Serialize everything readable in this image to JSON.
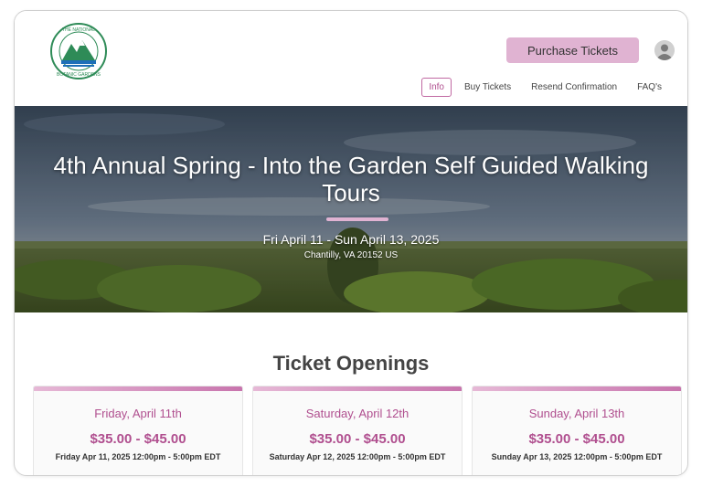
{
  "header": {
    "logo_text": "THE NATIONAL BOTANIC GARDENS",
    "purchase_button": "Purchase Tickets",
    "nav": [
      {
        "label": "Info",
        "active": true
      },
      {
        "label": "Buy Tickets",
        "active": false
      },
      {
        "label": "Resend Confirmation",
        "active": false
      },
      {
        "label": "FAQ's",
        "active": false
      }
    ]
  },
  "hero": {
    "title": "4th Annual Spring - Into the Garden Self Guided Walking Tours",
    "dates": "Fri April 11 - Sun April 13, 2025",
    "location": "Chantilly, VA 20152 US"
  },
  "tickets": {
    "title": "Ticket Openings",
    "cards": [
      {
        "day": "Friday, April 11th",
        "price": "$35.00 - $45.00",
        "time": "Friday Apr 11, 2025 12:00pm - 5:00pm EDT"
      },
      {
        "day": "Saturday, April 12th",
        "price": "$35.00 - $45.00",
        "time": "Saturday Apr 12, 2025 12:00pm - 5:00pm EDT"
      },
      {
        "day": "Sunday, April 13th",
        "price": "$35.00 - $45.00",
        "time": "Sunday Apr 13, 2025 12:00pm - 5:00pm EDT"
      }
    ]
  },
  "colors": {
    "accent_pink": "#e0b3d2",
    "accent_magenta": "#b04f8f",
    "logo_green": "#2e8b57",
    "logo_blue": "#1f6fb8"
  }
}
